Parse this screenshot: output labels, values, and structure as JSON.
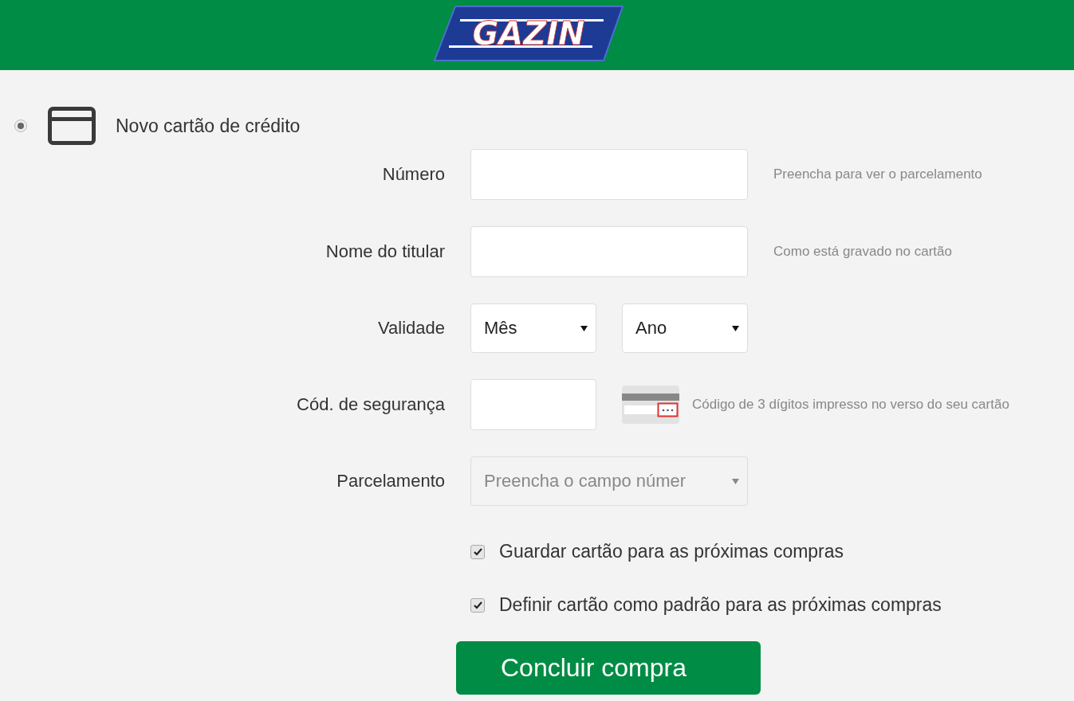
{
  "header": {
    "logo": "GAZIN"
  },
  "payment_option": {
    "label": "Novo cartão de crédito",
    "selected": true
  },
  "fields": [
    {
      "kind": "text",
      "label": "Número",
      "hint": "Preencha para ver o parcelamento"
    },
    {
      "kind": "text",
      "label": "Nome do titular",
      "hint": "Como está gravado no cartão"
    },
    {
      "kind": "selects",
      "label": "Validade",
      "selects": [
        {
          "value": "Mês"
        },
        {
          "value": "Ano"
        }
      ]
    },
    {
      "kind": "cvv",
      "label": "Cód. de segurança",
      "hint": "Código de 3 dígitos impresso no verso do seu cartão"
    },
    {
      "kind": "select",
      "label": "Parcelamento",
      "value": "Preencha o campo númer",
      "disabled": true
    }
  ],
  "options": [
    {
      "label": "Guardar cartão para as próximas compras",
      "checked": true
    },
    {
      "label": "Definir cartão como padrão para as próximas compras",
      "checked": true
    }
  ],
  "submit": {
    "label": "Concluir compra"
  }
}
